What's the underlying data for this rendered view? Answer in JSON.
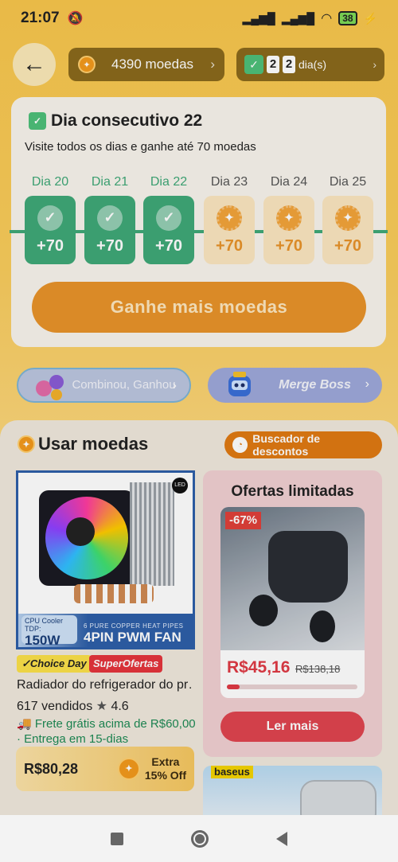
{
  "status_bar": {
    "time": "21:07",
    "battery": "38"
  },
  "header": {
    "coins_value": "4390 moedas",
    "days_digits": [
      "2",
      "2"
    ],
    "days_suffix": "dia(s)"
  },
  "checkin": {
    "title": "Dia consecutivo 22",
    "subtitle": "Visite todos os dias e ganhe até 70 moedas",
    "days": [
      {
        "label": "Dia 20",
        "reward": "+70",
        "done": true
      },
      {
        "label": "Dia 21",
        "reward": "+70",
        "done": true
      },
      {
        "label": "Dia 22",
        "reward": "+70",
        "done": true
      },
      {
        "label": "Dia 23",
        "reward": "+70",
        "done": false
      },
      {
        "label": "Dia 24",
        "reward": "+70",
        "done": false
      },
      {
        "label": "Dia 25",
        "reward": "+70",
        "done": false
      }
    ],
    "earn_button": "Ganhe mais moedas"
  },
  "banners": {
    "left": "Combinou, Ganhou",
    "right": "Merge Boss"
  },
  "use_coins": {
    "title": "Usar moedas",
    "finder_button": "Buscador de descontos"
  },
  "product": {
    "image_texts": {
      "led": "LED",
      "cpu_cooler": "CPU Cooler",
      "tdp": "TDP:",
      "watt": "150W",
      "pipes": "6 PURE COPPER HEAT PIPES",
      "fan": "4PIN PWM FAN"
    },
    "tag_choice": "Choice Day",
    "tag_super": "SuperOfertas",
    "title": "Radiador do refrigerador do pr…",
    "sold": "617 vendidos",
    "rating": "4.6",
    "shipping": "Frete grátis acima de R$60,00 · Entrega em 15-dias",
    "price": "R$80,28",
    "extra_line1": "Extra",
    "extra_line2": "15% Off"
  },
  "limited_offers": {
    "title": "Ofertas limitadas",
    "discount": "-67%",
    "price": "R$45,16",
    "old_price": "R$138,18",
    "progress": 0.1,
    "button": "Ler mais"
  },
  "next_card": {
    "brand": "baseus"
  },
  "colors": {
    "accent_orange": "#e8932a",
    "green": "#3fa877",
    "red": "#e0454f"
  }
}
